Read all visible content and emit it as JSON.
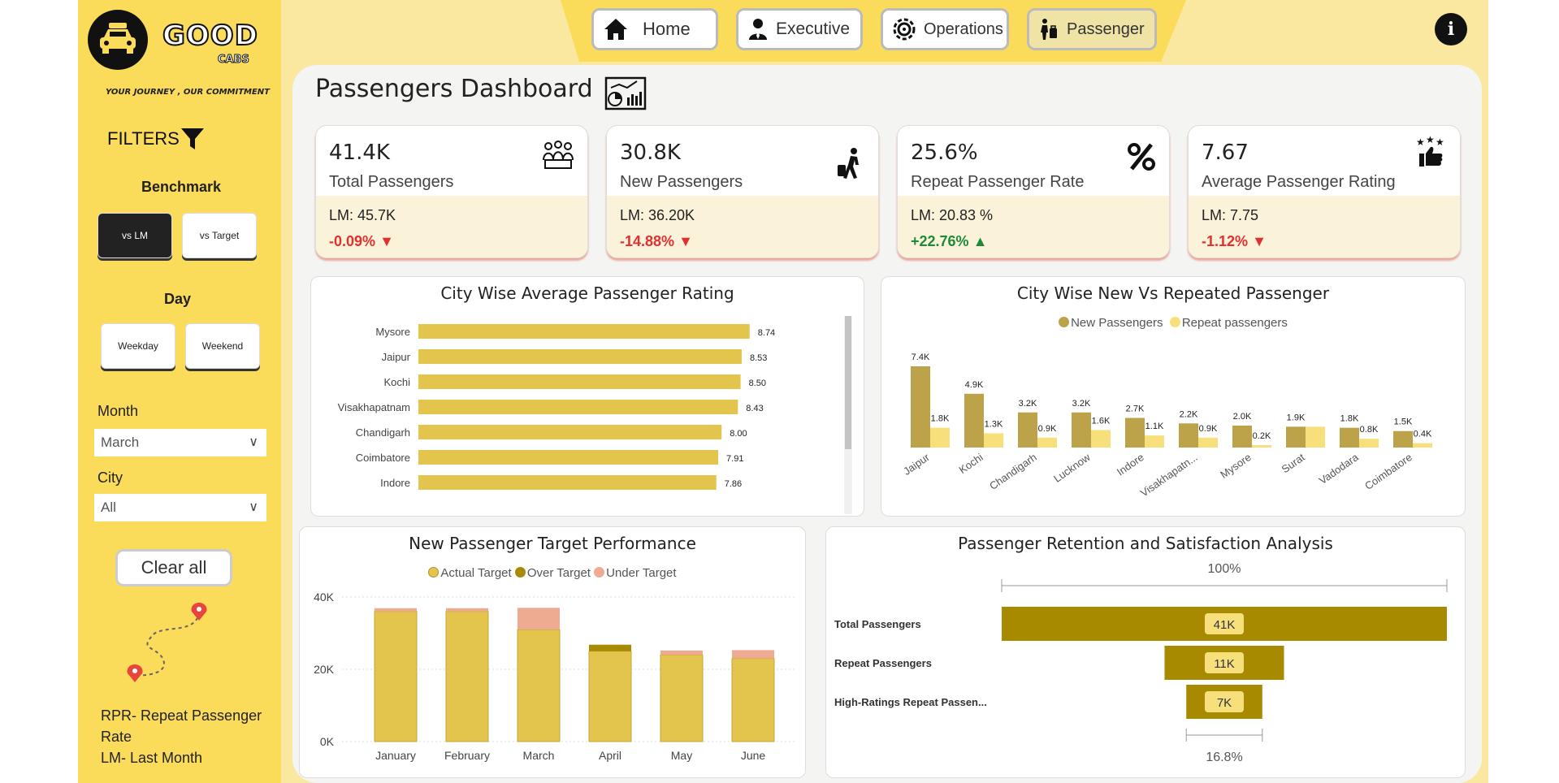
{
  "brand": {
    "logo_text": "GOOD",
    "logo_sub": "CABS",
    "tagline": "YOUR JOURNEY , OUR COMMITMENT"
  },
  "filters": {
    "title": "FILTERS",
    "benchmark": {
      "label": "Benchmark",
      "options": [
        "vs LM",
        "vs Target"
      ],
      "selected": "vs LM"
    },
    "day": {
      "label": "Day",
      "options": [
        "Weekday",
        "Weekend"
      ]
    },
    "month": {
      "label": "Month",
      "value": "March"
    },
    "city": {
      "label": "City",
      "value": "All"
    },
    "clear_label": "Clear all"
  },
  "notes": {
    "line1": "RPR- Repeat Passenger Rate",
    "line2": "LM- Last Month"
  },
  "nav": {
    "tabs": [
      "Home",
      "Executive",
      "Operations",
      "Passenger"
    ],
    "active": "Passenger",
    "info_label": "i"
  },
  "page": {
    "title": "Passengers Dashboard"
  },
  "kpis": [
    {
      "value": "41.4K",
      "label": "Total Passengers",
      "lm": "LM: 45.7K",
      "change": "-0.09%",
      "direction": "down",
      "icon": "people-group-icon"
    },
    {
      "value": "30.8K",
      "label": "New Passengers",
      "lm": "LM: 36.20K",
      "change": "-14.88%",
      "direction": "down",
      "icon": "traveler-icon"
    },
    {
      "value": "25.6%",
      "label": "Repeat Passenger Rate",
      "lm": "LM: 20.83 %",
      "change": "+22.76%",
      "direction": "up",
      "icon": "percent-icon"
    },
    {
      "value": "7.67",
      "label": "Average Passenger Rating",
      "lm": "LM: 7.75",
      "change": "-1.12%",
      "direction": "down",
      "icon": "rating-thumbs-icon"
    }
  ],
  "colors": {
    "gold": "#e3c44c",
    "dark_gold": "#bca34a",
    "light_yellow": "#f7e07c",
    "olive": "#a78a00",
    "salmon": "#efab92",
    "neg": "#e03030",
    "pos": "#1d8a3a",
    "sidebar": "#fbdb5a"
  },
  "chart_data": [
    {
      "type": "bar",
      "orientation": "horizontal",
      "title": "City Wise Average Passenger Rating",
      "categories": [
        "Mysore",
        "Jaipur",
        "Kochi",
        "Visakhapatnam",
        "Chandigarh",
        "Coimbatore",
        "Indore"
      ],
      "values": [
        8.74,
        8.53,
        8.5,
        8.43,
        8.0,
        7.91,
        7.86
      ],
      "labels": [
        "8.74",
        "8.53",
        "8.50",
        "8.43",
        "8.00",
        "7.91",
        "7.86"
      ],
      "xlim": [
        0,
        9
      ]
    },
    {
      "type": "bar",
      "title": "City Wise New Vs Repeated Passenger",
      "categories": [
        "Jaipur",
        "Kochi",
        "Chandigarh",
        "Lucknow",
        "Indore",
        "Visakhapatn...",
        "Mysore",
        "Surat",
        "Vadodara",
        "Coimbatore"
      ],
      "series": [
        {
          "name": "New Passengers",
          "values": [
            7.4,
            4.9,
            3.2,
            3.2,
            2.7,
            2.2,
            2.0,
            1.9,
            1.8,
            1.5
          ],
          "labels": [
            "7.4K",
            "4.9K",
            "3.2K",
            "3.2K",
            "2.7K",
            "2.2K",
            "2.0K",
            "1.9K",
            "1.8K",
            "1.5K"
          ]
        },
        {
          "name": "Repeat passengers",
          "values": [
            1.8,
            1.3,
            0.9,
            1.6,
            1.1,
            0.9,
            0.2,
            1.9,
            0.8,
            0.4
          ],
          "labels": [
            "1.8K",
            "1.3K",
            "0.9K",
            "1.6K",
            "1.1K",
            "0.9K",
            "0.2K",
            "",
            "0.8K",
            "0.4K"
          ]
        }
      ],
      "legend": "top-center"
    },
    {
      "type": "bar",
      "stacked": true,
      "title": "New Passenger Target Performance",
      "categories": [
        "January",
        "February",
        "March",
        "April",
        "May",
        "June"
      ],
      "series": [
        {
          "name": "Actual Target",
          "values": [
            36000,
            36000,
            31000,
            25000,
            24000,
            23000
          ]
        },
        {
          "name": "Over Target",
          "values": [
            0,
            0,
            0,
            1800,
            0,
            0
          ]
        },
        {
          "name": "Under Target",
          "values": [
            900,
            900,
            6000,
            0,
            1200,
            2300
          ]
        }
      ],
      "yticks": [
        "0K",
        "20K",
        "40K"
      ],
      "ylim": [
        0,
        40000
      ],
      "legend": "top-center"
    },
    {
      "type": "funnel",
      "title": "Passenger Retention and Satisfaction Analysis",
      "top_label": "100%",
      "bottom_label": "16.8%",
      "stages": [
        {
          "name": "Total Passengers",
          "value": 41,
          "label": "41K"
        },
        {
          "name": "Repeat Passengers",
          "value": 11,
          "label": "11K"
        },
        {
          "name": "High-Ratings Repeat Passen...",
          "value": 7,
          "label": "7K"
        }
      ]
    }
  ]
}
